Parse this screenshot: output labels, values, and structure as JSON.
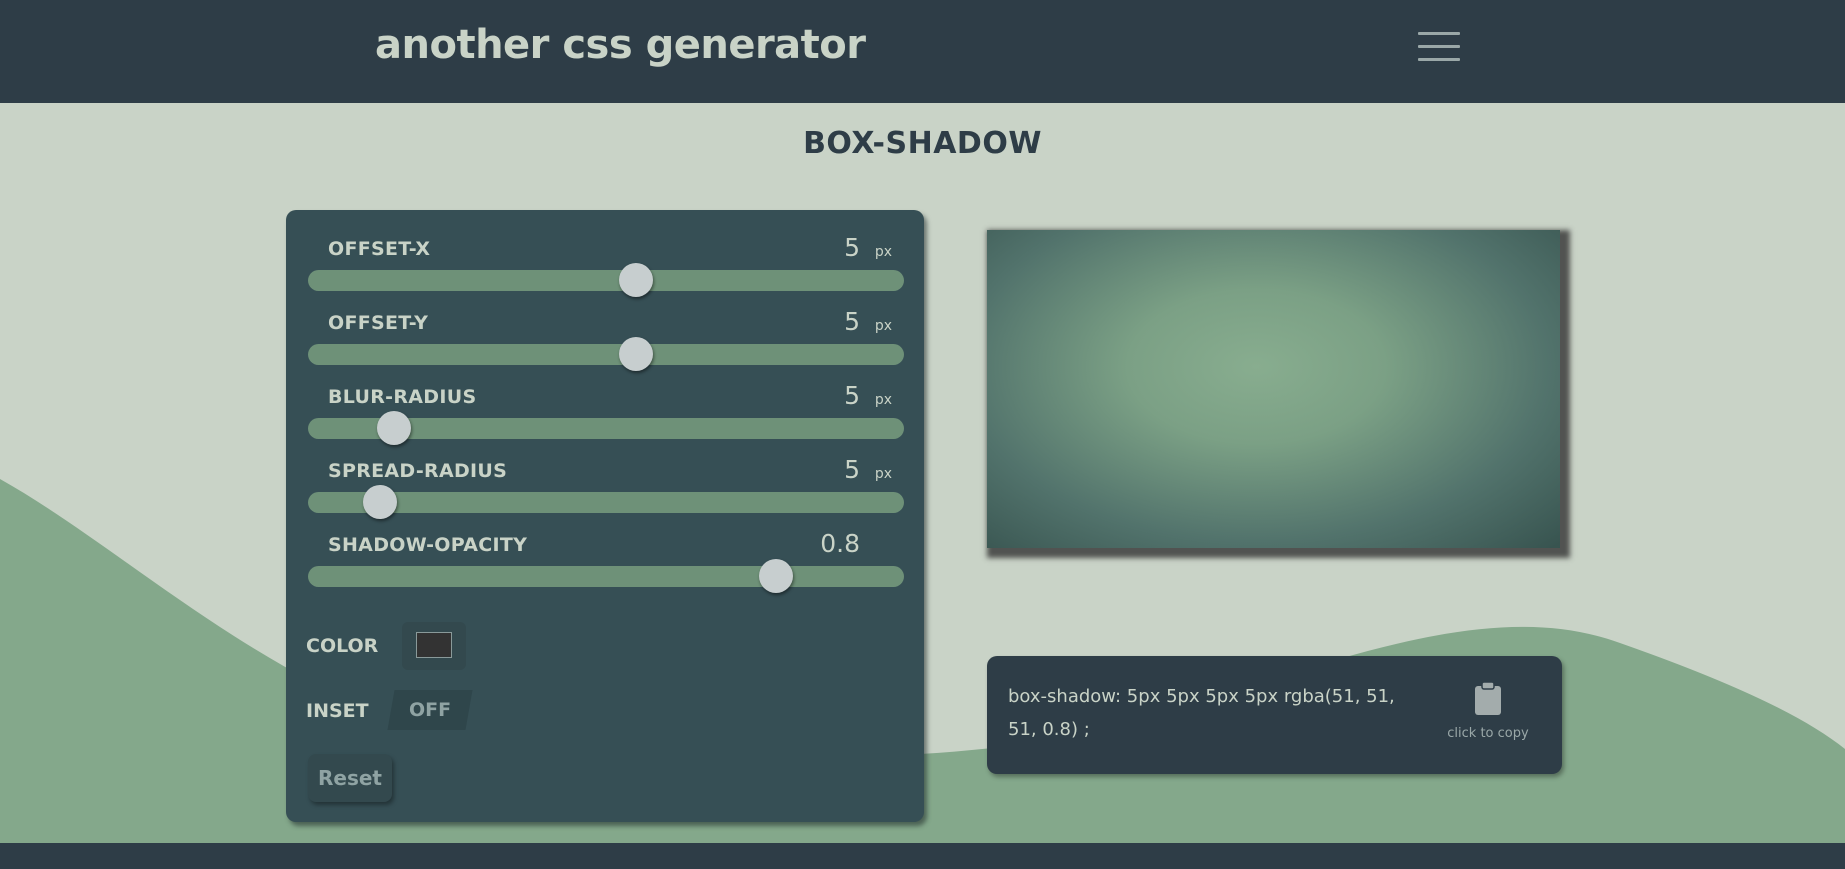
{
  "header": {
    "title": "another css generator",
    "menu_icon": "hamburger-menu-icon"
  },
  "page": {
    "title": "BOX-SHADOW"
  },
  "controls": {
    "sliders": [
      {
        "label": "OFFSET-X",
        "value": "5",
        "unit": "px",
        "position": 0.55
      },
      {
        "label": "OFFSET-Y",
        "value": "5",
        "unit": "px",
        "position": 0.55
      },
      {
        "label": "BLUR-RADIUS",
        "value": "5",
        "unit": "px",
        "position": 0.145
      },
      {
        "label": "SPREAD-RADIUS",
        "value": "5",
        "unit": "px",
        "position": 0.12
      },
      {
        "label": "SHADOW-OPACITY",
        "value": "0.8",
        "unit": "",
        "position": 0.785
      }
    ],
    "color_label": "COLOR",
    "color_value": "#333333",
    "inset_label": "INSET",
    "inset_state": "OFF",
    "reset_label": "Reset"
  },
  "output": {
    "code": "box-shadow: 5px 5px 5px 5px rgba(51, 51, 51, 0.8) ;",
    "copy_label": "click to copy",
    "copy_icon": "clipboard-icon"
  },
  "colors": {
    "header_bg": "#2e3d47",
    "page_bg": "#c9d3c7",
    "panel_bg": "#364f55",
    "track": "#6e9178",
    "wave": "#84a88b"
  }
}
